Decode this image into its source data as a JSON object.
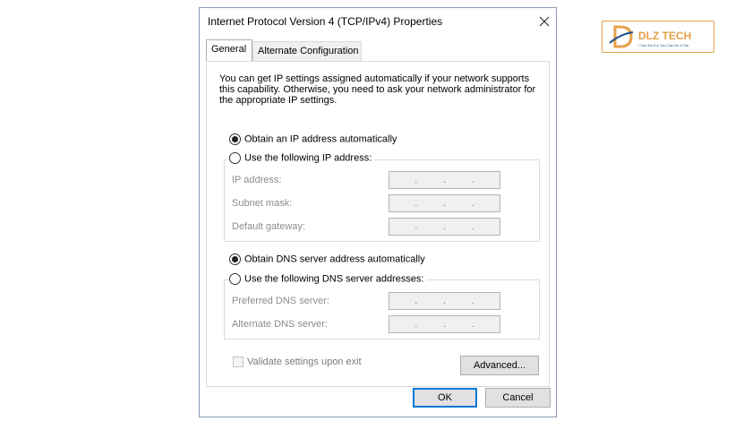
{
  "window": {
    "title": "Internet Protocol Version 4 (TCP/IPv4) Properties"
  },
  "tabs": [
    {
      "label": "General",
      "active": true
    },
    {
      "label": "Alternate Configuration",
      "active": false
    }
  ],
  "description": "You can get IP settings assigned automatically if your network supports this capability. Otherwise, you need to ask your network administrator for the appropriate IP settings.",
  "ip_section": {
    "auto_label": "Obtain an IP address automatically",
    "manual_label": "Use the following IP address:",
    "selected": "auto",
    "fields": [
      {
        "label": "IP address:",
        "value": ".   .   ."
      },
      {
        "label": "Subnet mask:",
        "value": ".   .   ."
      },
      {
        "label": "Default gateway:",
        "value": ".   .   ."
      }
    ]
  },
  "dns_section": {
    "auto_label": "Obtain DNS server address automatically",
    "manual_label": "Use the following DNS server addresses:",
    "selected": "auto",
    "fields": [
      {
        "label": "Preferred DNS server:",
        "value": ".   .   ."
      },
      {
        "label": "Alternate DNS server:",
        "value": ".   .   ."
      }
    ]
  },
  "validate": {
    "label": "Validate settings upon exit",
    "checked": false
  },
  "buttons": {
    "advanced": "Advanced...",
    "ok": "OK",
    "cancel": "Cancel"
  },
  "logo": {
    "text": "DLZ TECH",
    "tagline": "I Can Do It & You Can Do It Too",
    "brand_color": "#e6a04a",
    "accent_color": "#1f4e8c"
  }
}
